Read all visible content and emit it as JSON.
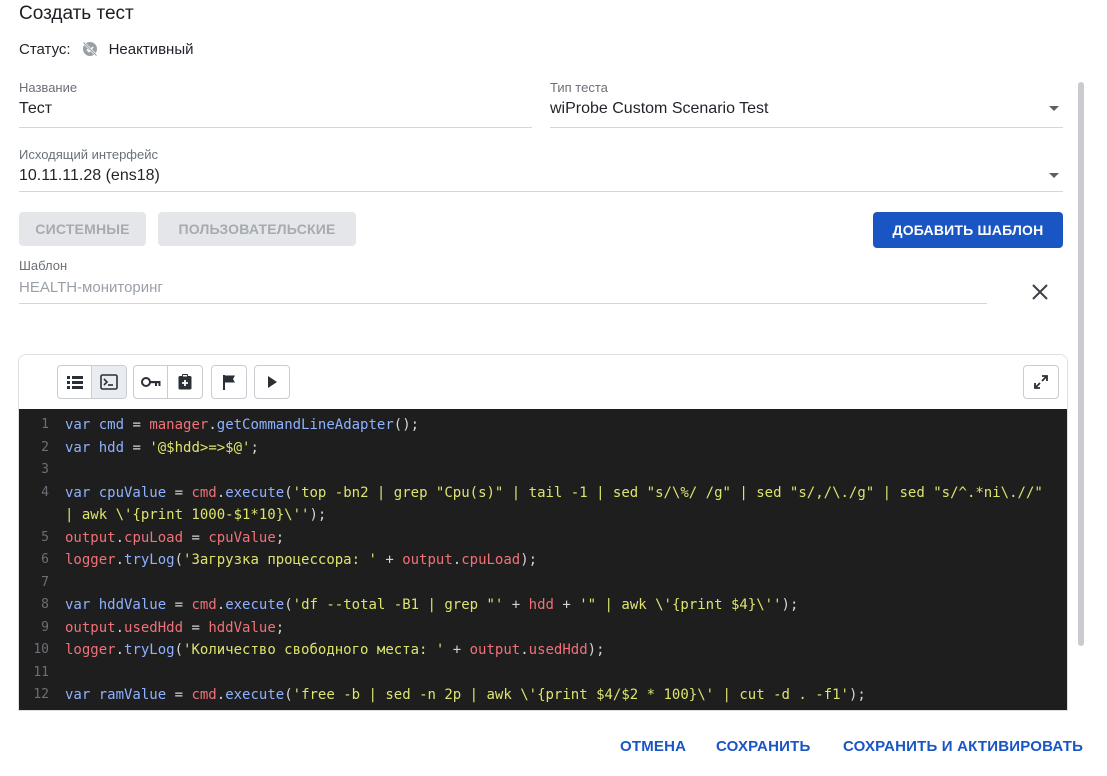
{
  "page": {
    "title": "Создать тест"
  },
  "status": {
    "label": "Статус:",
    "value": "Неактивный"
  },
  "fields": {
    "name": {
      "label": "Название",
      "value": "Тест"
    },
    "test_type": {
      "label": "Тип теста",
      "value": "wiProbe Custom Scenario Test"
    },
    "interface": {
      "label": "Исходящий интерфейс",
      "value": "10.11.11.28 (ens18)"
    },
    "template": {
      "label": "Шаблон",
      "value": "HEALTH-мониторинг"
    }
  },
  "chips": {
    "system": "СИСТЕМНЫЕ",
    "user": "ПОЛЬЗОВАТЕЛЬСКИЕ"
  },
  "add_template_label": "ДОБАВИТЬ ШАБЛОН",
  "editor": {
    "toolbar_icons": [
      "list-icon",
      "terminal-icon",
      "key-icon",
      "clipboard-add-icon",
      "flag-icon",
      "play-icon",
      "fullscreen-icon"
    ],
    "lines": [
      {
        "n": "1",
        "cont": false,
        "tokens": [
          [
            "kw",
            "var "
          ],
          [
            "vr",
            "cmd"
          ],
          [
            "pl",
            " = "
          ],
          [
            "ob",
            "manager"
          ],
          [
            "pl",
            "."
          ],
          [
            "vr",
            "getCommandLineAdapter"
          ],
          [
            "pl",
            "();"
          ]
        ]
      },
      {
        "n": "2",
        "cont": false,
        "tokens": [
          [
            "kw",
            "var "
          ],
          [
            "vr",
            "hdd"
          ],
          [
            "pl",
            " = "
          ],
          [
            "st",
            "'@$hdd>=>$@'"
          ],
          [
            "pl",
            ";"
          ]
        ]
      },
      {
        "n": "3",
        "cont": false,
        "tokens": []
      },
      {
        "n": "4",
        "cont": false,
        "tokens": [
          [
            "kw",
            "var "
          ],
          [
            "vr",
            "cpuValue"
          ],
          [
            "pl",
            " = "
          ],
          [
            "ob",
            "cmd"
          ],
          [
            "pl",
            "."
          ],
          [
            "vr",
            "execute"
          ],
          [
            "pl",
            "("
          ],
          [
            "st",
            "'top -bn2 | grep \"Cpu(s)\" | tail -1 | sed \"s/\\%/ /g\" | sed \"s/,/\\./g\" | sed \"s/^.*ni\\.//\""
          ]
        ]
      },
      {
        "n": "",
        "cont": true,
        "tokens": [
          [
            "st",
            "| awk \\'{print 1000-$1*10}\\''"
          ],
          [
            "pl",
            ");"
          ]
        ]
      },
      {
        "n": "5",
        "cont": false,
        "tokens": [
          [
            "ob",
            "output"
          ],
          [
            "pl",
            "."
          ],
          [
            "ob",
            "cpuLoad"
          ],
          [
            "pl",
            " = "
          ],
          [
            "ob",
            "cpuValue"
          ],
          [
            "pl",
            ";"
          ]
        ]
      },
      {
        "n": "6",
        "cont": false,
        "tokens": [
          [
            "ob",
            "logger"
          ],
          [
            "pl",
            "."
          ],
          [
            "vr",
            "tryLog"
          ],
          [
            "pl",
            "("
          ],
          [
            "st",
            "'Загрузка процессора: '"
          ],
          [
            "pl",
            " + "
          ],
          [
            "ob",
            "output"
          ],
          [
            "pl",
            "."
          ],
          [
            "ob",
            "cpuLoad"
          ],
          [
            "pl",
            ");"
          ]
        ]
      },
      {
        "n": "7",
        "cont": false,
        "tokens": []
      },
      {
        "n": "8",
        "cont": false,
        "tokens": [
          [
            "kw",
            "var "
          ],
          [
            "vr",
            "hddValue"
          ],
          [
            "pl",
            " = "
          ],
          [
            "ob",
            "cmd"
          ],
          [
            "pl",
            "."
          ],
          [
            "vr",
            "execute"
          ],
          [
            "pl",
            "("
          ],
          [
            "st",
            "'df --total -B1 | grep \"'"
          ],
          [
            "pl",
            " + "
          ],
          [
            "ob",
            "hdd"
          ],
          [
            "pl",
            " + "
          ],
          [
            "st",
            "'\" | awk \\'{print $4}\\''"
          ],
          [
            "pl",
            ");"
          ]
        ]
      },
      {
        "n": "9",
        "cont": false,
        "tokens": [
          [
            "ob",
            "output"
          ],
          [
            "pl",
            "."
          ],
          [
            "ob",
            "usedHdd"
          ],
          [
            "pl",
            " = "
          ],
          [
            "ob",
            "hddValue"
          ],
          [
            "pl",
            ";"
          ]
        ]
      },
      {
        "n": "10",
        "cont": false,
        "tokens": [
          [
            "ob",
            "logger"
          ],
          [
            "pl",
            "."
          ],
          [
            "vr",
            "tryLog"
          ],
          [
            "pl",
            "("
          ],
          [
            "st",
            "'Количество свободного места: '"
          ],
          [
            "pl",
            " + "
          ],
          [
            "ob",
            "output"
          ],
          [
            "pl",
            "."
          ],
          [
            "ob",
            "usedHdd"
          ],
          [
            "pl",
            ");"
          ]
        ]
      },
      {
        "n": "11",
        "cont": false,
        "tokens": []
      },
      {
        "n": "12",
        "cont": false,
        "tokens": [
          [
            "kw",
            "var "
          ],
          [
            "vr",
            "ramValue"
          ],
          [
            "pl",
            " = "
          ],
          [
            "ob",
            "cmd"
          ],
          [
            "pl",
            "."
          ],
          [
            "vr",
            "execute"
          ],
          [
            "pl",
            "("
          ],
          [
            "st",
            "'free -b | sed -n 2p | awk \\'{print $4/$2 * 100}\\' | cut -d . -f1'"
          ],
          [
            "pl",
            ");"
          ]
        ]
      }
    ]
  },
  "footer": {
    "cancel": "ОТМЕНА",
    "save": "СОХРАНИТЬ",
    "save_activate": "СОХРАНИТЬ И АКТИВИРОВАТЬ"
  },
  "colors": {
    "primary": "#1a55c4",
    "code_bg": "#1e1e1e",
    "keyword": "#8fb1ff",
    "object": "#f07178",
    "string": "#dde46e"
  }
}
